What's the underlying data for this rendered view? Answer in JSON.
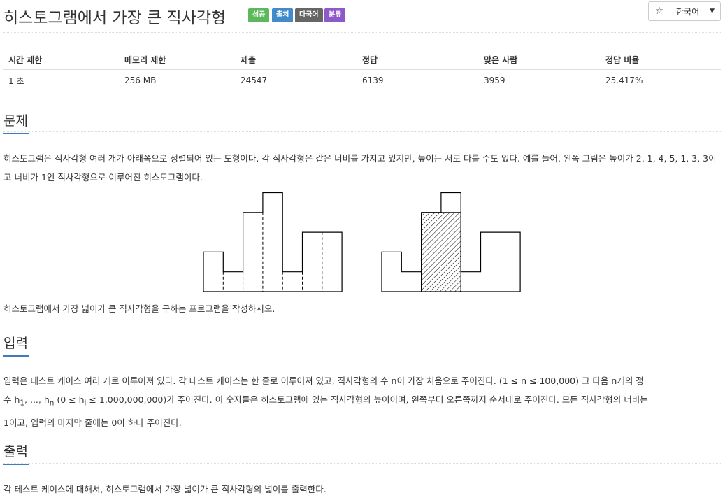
{
  "header": {
    "title": "히스토그램에서 가장 큰 직사각형",
    "labels": [
      {
        "text": "성공",
        "color": "#5cb85c"
      },
      {
        "text": "출처",
        "color": "#428bca"
      },
      {
        "text": "다국어",
        "color": "#666666"
      },
      {
        "text": "분류",
        "color": "#8e5ac8"
      }
    ],
    "star_icon": "☆",
    "language": "한국어"
  },
  "info_table": {
    "headers": [
      "시간 제한",
      "메모리 제한",
      "제출",
      "정답",
      "맞은 사람",
      "정답 비율"
    ],
    "values": [
      "1 초",
      "256 MB",
      "24547",
      "6139",
      "3959",
      "25.417%"
    ]
  },
  "problem": {
    "heading": "문제",
    "para1": "히스토그램은 직사각형 여러 개가 아래쪽으로 정렬되어 있는 도형이다. 각 직사각형은 같은 너비를 가지고 있지만, 높이는 서로 다를 수도 있다. 예를 들어, 왼쪽 그림은 높이가 2, 1, 4, 5, 1, 3, 3이고 너비가 1인 직사각형으로 이루어진 히스토그램이다.",
    "para2": "히스토그램에서 가장 넓이가 큰 직사각형을 구하는 프로그램을 작성하시오.",
    "heights": [
      2,
      1,
      4,
      5,
      1,
      3,
      3
    ]
  },
  "input": {
    "heading": "입력",
    "line1": "입력은 테스트 케이스 여러 개로 이루어져 있다. 각 테스트 케이스는 한 줄로 이루어져 있고, 직사각형의 수 n이 가장 처음으로 주어진다. (1 ≤ n ≤ 100,000) 그 다음 n개의 정",
    "line2_prefix": "수 h",
    "line2_mid": ", ..., h",
    "line2_suffix_a": " (0 ≤ h",
    "line2_suffix_b": " ≤ 1,000,000,000)가 주어진다. 이 숫자들은 히스토그램에 있는 직사각형의 높이이며, 왼쪽부터 오른쪽까지 순서대로 주어진다. 모든 직사각형의 너비는",
    "sub1": "1",
    "subn": "n",
    "subi": "i",
    "line3": "1이고, 입력의 마지막 줄에는 0이 하나 주어진다."
  },
  "output": {
    "heading": "출력",
    "para": "각 테스트 케이스에 대해서, 히스토그램에서 가장 넓이가 큰 직사각형의 넓이를 출력한다."
  }
}
